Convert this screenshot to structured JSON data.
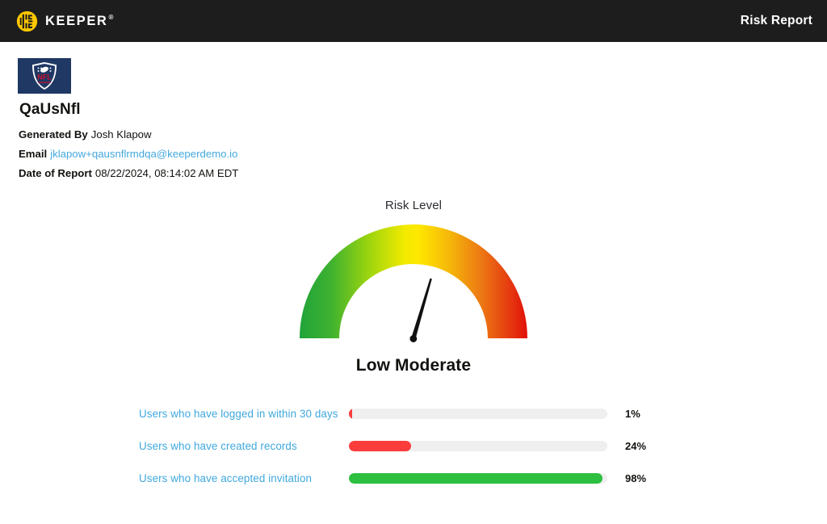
{
  "header": {
    "brand_name": "KEEPER",
    "brand_tm": "®",
    "brand_icon": "keeper-logo-icon",
    "report_title": "Risk Report"
  },
  "meta": {
    "org_logo_icon": "nfl-shield-logo",
    "org_name": "QaUsNfl",
    "rows": [
      {
        "key": "Generated By",
        "value": "Josh Klapow",
        "is_link": false
      },
      {
        "key": "Email",
        "value": "jklapow+qausnflrmdqa@keeperdemo.io",
        "is_link": true
      },
      {
        "key": "Date of Report",
        "value": "08/22/2024, 08:14:02 AM EDT",
        "is_link": false
      }
    ]
  },
  "gauge": {
    "title": "Risk Level",
    "level_label": "Low Moderate",
    "needle_angle_deg": 15,
    "colors": {
      "green": "#2ba831",
      "yellow_green": "#8fd014",
      "yellow": "#ffe800",
      "orange": "#f08a13",
      "red": "#e82010"
    }
  },
  "chart_data": {
    "type": "bar",
    "title": "",
    "orientation": "horizontal",
    "xlabel": "",
    "ylabel": "",
    "xlim": [
      0,
      100
    ],
    "grid": false,
    "legend": "none",
    "categories": [
      "Users who have logged in within 30 days",
      "Users who have created records",
      "Users who have accepted invitation"
    ],
    "values": [
      1,
      24,
      98
    ],
    "value_labels": [
      "1%",
      "24%",
      "98%"
    ],
    "bar_colors": [
      "#fa3c3c",
      "#fa3c3c",
      "#2dbf3f"
    ],
    "track_color": "#efefef"
  },
  "colors": {
    "header_bg": "#1d1d1d",
    "brand_gold": "#ffc700",
    "label_blue": "#3fa8dd",
    "text_dark": "#12120f",
    "org_navy": "#1f3864"
  }
}
